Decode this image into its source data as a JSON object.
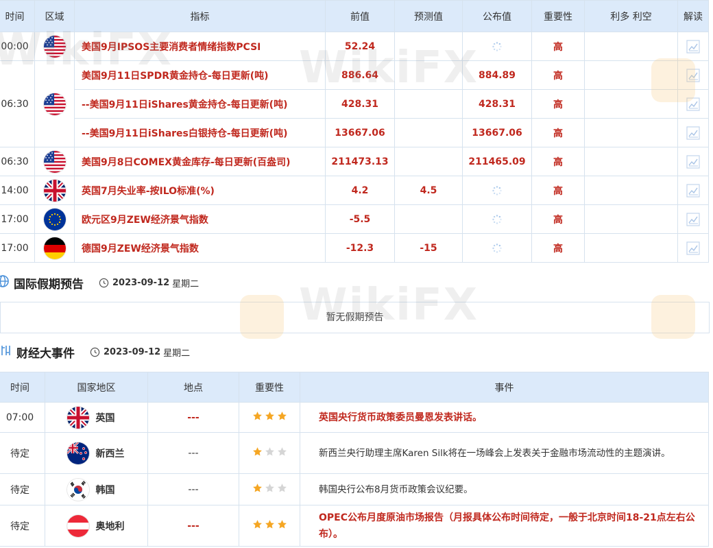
{
  "econ": {
    "headers": {
      "time": "时间",
      "region": "区域",
      "indicator": "指标",
      "prev": "前值",
      "forecast": "预测值",
      "actual": "公布值",
      "importance": "重要性",
      "bullbear": "利多 利空",
      "analysis": "解读"
    },
    "rows": [
      {
        "time": "00:00",
        "flag": "us",
        "indicator": "美国9月IPSOS主要消费者情绪指数PCSI",
        "prev": "52.24",
        "forecast": "",
        "actual": "",
        "actual_loading": true,
        "importance": "高"
      },
      {
        "time": "06:30",
        "flag": "us",
        "indicator": "美国9月11日SPDR黄金持仓-每日更新(吨)",
        "prev": "886.64",
        "forecast": "",
        "actual": "884.89",
        "actual_loading": false,
        "importance": "高"
      },
      {
        "time": "",
        "flag": "",
        "indicator": "--美国9月11日iShares黄金持仓-每日更新(吨)",
        "prev": "428.31",
        "forecast": "",
        "actual": "428.31",
        "actual_loading": false,
        "importance": "高"
      },
      {
        "time": "",
        "flag": "",
        "indicator": "--美国9月11日iShares白银持仓-每日更新(吨)",
        "prev": "13667.06",
        "forecast": "",
        "actual": "13667.06",
        "actual_loading": false,
        "importance": "高"
      },
      {
        "time": "06:30",
        "flag": "us",
        "indicator": "美国9月8日COMEX黄金库存-每日更新(百盎司)",
        "prev": "211473.13",
        "forecast": "",
        "actual": "211465.09",
        "actual_loading": false,
        "importance": "高"
      },
      {
        "time": "14:00",
        "flag": "uk",
        "indicator": "英国7月失业率-按ILO标准(%)",
        "prev": "4.2",
        "forecast": "4.5",
        "actual": "",
        "actual_loading": true,
        "importance": "高"
      },
      {
        "time": "17:00",
        "flag": "eu",
        "indicator": "欧元区9月ZEW经济景气指数",
        "prev": "-5.5",
        "forecast": "",
        "actual": "",
        "actual_loading": true,
        "importance": "高"
      },
      {
        "time": "17:00",
        "flag": "de",
        "indicator": "德国9月ZEW经济景气指数",
        "prev": "-12.3",
        "forecast": "-15",
        "actual": "",
        "actual_loading": true,
        "importance": "高"
      }
    ]
  },
  "holiday": {
    "title": "国际假期预告",
    "date": "2023-09-12",
    "weekday": "星期二",
    "empty": "暂无假期预告"
  },
  "events": {
    "title": "财经大事件",
    "date": "2023-09-12",
    "weekday": "星期二",
    "headers": {
      "time": "时间",
      "country": "国家地区",
      "location": "地点",
      "importance": "重要性",
      "event": "事件"
    },
    "rows": [
      {
        "time": "07:00",
        "flag": "uk",
        "country": "英国",
        "location": "---",
        "stars": 3,
        "event": "英国央行货币政策委员曼恩发表讲话。",
        "highlight": true
      },
      {
        "time": "待定",
        "flag": "nz",
        "country": "新西兰",
        "location": "---",
        "stars": 1,
        "event": "新西兰央行助理主席Karen Silk将在一场峰会上发表关于金融市场流动性的主题演讲。",
        "highlight": false
      },
      {
        "time": "待定",
        "flag": "kr",
        "country": "韩国",
        "location": "---",
        "stars": 1,
        "event": "韩国央行公布8月货币政策会议纪要。",
        "highlight": false
      },
      {
        "time": "待定",
        "flag": "at",
        "country": "奥地利",
        "location": "---",
        "stars": 3,
        "event": "OPEC公布月度原油市场报告（月报具体公布时间待定，一般于北京时间18-21点左右公布）。",
        "highlight": true
      }
    ]
  },
  "watermark": "WikiFX",
  "colors": {
    "accent_red": "#c0281e",
    "header_bg": "#dceafa",
    "star_gold": "#f5a623",
    "star_grey": "#d5d5d5"
  }
}
